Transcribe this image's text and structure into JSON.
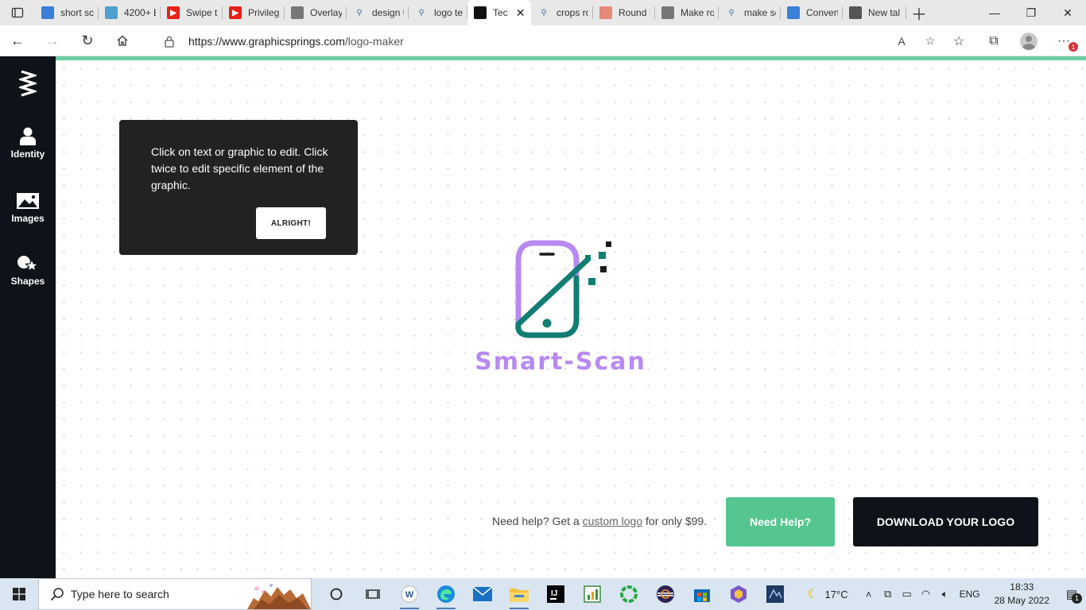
{
  "browser": {
    "tabs": [
      {
        "title": "short sc",
        "favicon": "bing-icon",
        "color": "#3b7fd6"
      },
      {
        "title": "4200+ E",
        "favicon": "vector-icon",
        "color": "#4f9fcf"
      },
      {
        "title": "Swipe t",
        "favicon": "youtube-icon",
        "color": "#e62117"
      },
      {
        "title": "Privileg",
        "favicon": "youtube-icon",
        "color": "#e62117"
      },
      {
        "title": "Overlay",
        "favicon": "io-icon",
        "color": "#777777"
      },
      {
        "title": "design t",
        "favicon": "search-icon",
        "color": "#6a8fb5"
      },
      {
        "title": "logo te",
        "favicon": "search-icon",
        "color": "#6a8fb5"
      },
      {
        "title": "Tec",
        "favicon": "graphicsprings-icon",
        "color": "#111111",
        "active": true
      },
      {
        "title": "crops ro",
        "favicon": "search-icon",
        "color": "#6a8fb5"
      },
      {
        "title": "Round I",
        "favicon": "image-icon",
        "color": "#e58a7a"
      },
      {
        "title": "Make ro",
        "favicon": "io-icon",
        "color": "#777777"
      },
      {
        "title": "make sc",
        "favicon": "search-icon",
        "color": "#6a8fb5"
      },
      {
        "title": "Convert",
        "favicon": "convert-icon",
        "color": "#3b7fd6"
      },
      {
        "title": "New tal",
        "favicon": "newtab-icon",
        "color": "#555555"
      }
    ],
    "url_host": "https://www.graphicsprings.com",
    "url_path": "/logo-maker",
    "read_aloud": "A",
    "notification_count": "1"
  },
  "sidebar": {
    "items": [
      {
        "label": "Identity",
        "icon": "person-icon"
      },
      {
        "label": "Images",
        "icon": "image-icon"
      },
      {
        "label": "Shapes",
        "icon": "shapes-icon"
      }
    ]
  },
  "tooltip": {
    "text": "Click on text or graphic to edit. Click twice to edit specific element of the graphic.",
    "button": "ALRIGHT!"
  },
  "logo": {
    "name": "Smart-Scan",
    "colors": {
      "purple": "#b889f2",
      "teal": "#127d73",
      "dark": "#1a1a1a"
    }
  },
  "help": {
    "prefix": "Need help? Get a",
    "link": "custom logo",
    "suffix": "for only $99.",
    "need_help_button": "Need Help?",
    "download_button": "DOWNLOAD YOUR LOGO"
  },
  "taskbar": {
    "search_placeholder": "Type here to search",
    "weather": "17°C",
    "language": "ENG",
    "time": "18:33",
    "date": "28 May 2022",
    "action_center_count": "1"
  },
  "colors": {
    "accent": "#6ecfa7",
    "sidebar": "#0d1318",
    "help_button": "#56c690",
    "download_button": "#0d1318"
  }
}
